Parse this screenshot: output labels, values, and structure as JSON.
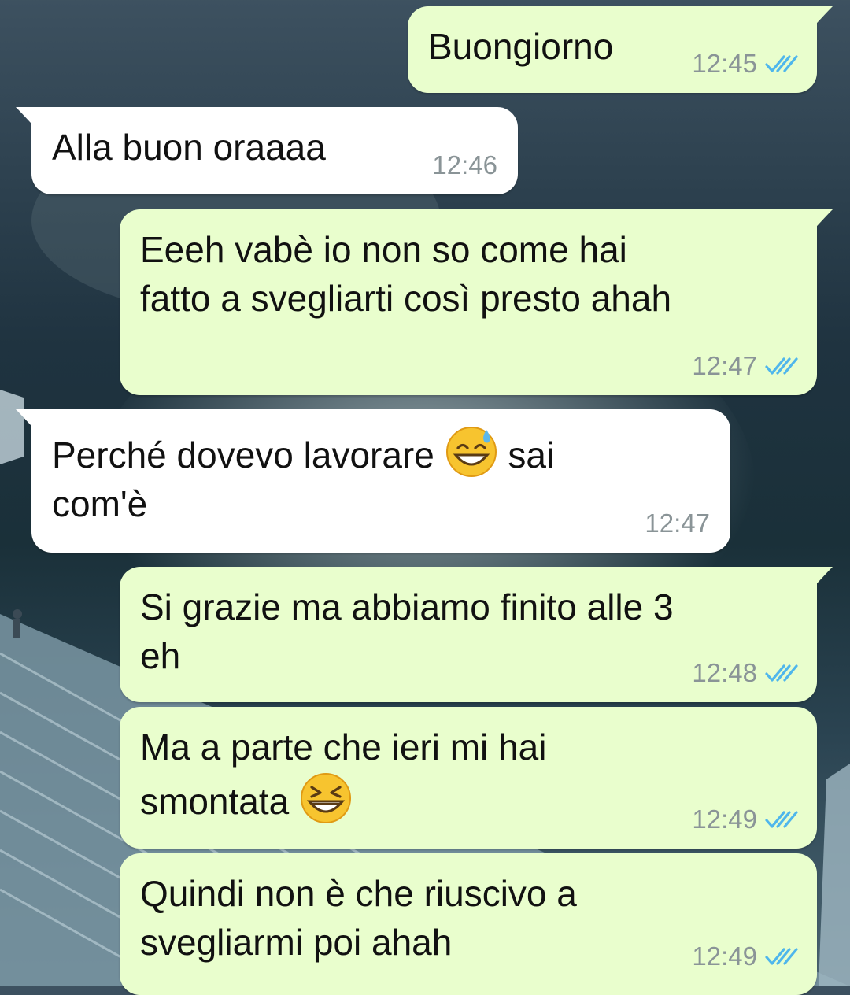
{
  "conversation": {
    "messages": [
      {
        "direction": "outgoing",
        "lines": [
          "Buongiorno"
        ],
        "time": "12:45",
        "status": "read"
      },
      {
        "direction": "incoming",
        "lines": [
          "Alla buon oraaaa"
        ],
        "time": "12:46"
      },
      {
        "direction": "outgoing",
        "lines": [
          "Eeeh vabè io non so come hai",
          "fatto a svegliarti così presto ahah"
        ],
        "time": "12:47",
        "status": "read"
      },
      {
        "direction": "incoming",
        "lines": [
          "Perché dovevo lavorare ",
          " sai",
          "com'è"
        ],
        "time": "12:47",
        "emoji": "sweat-smile-emoji"
      },
      {
        "direction": "outgoing",
        "lines": [
          "Si grazie ma abbiamo finito alle 3",
          "eh"
        ],
        "time": "12:48",
        "status": "read"
      },
      {
        "direction": "outgoing",
        "lines": [
          "Ma a parte che ieri mi hai",
          "smontata "
        ],
        "time": "12:49",
        "status": "read",
        "emoji": "squinting-laugh-emoji"
      },
      {
        "direction": "outgoing",
        "lines": [
          "Quindi non è che riuscivo a",
          "svegliarmi poi ahah"
        ],
        "time": "12:49",
        "status": "read"
      }
    ]
  },
  "theme": {
    "outgoing_bubble": "#e9fecd",
    "incoming_bubble": "#ffffff",
    "read_ticks": "#4fb6ec",
    "timestamp": "#8a9497"
  }
}
